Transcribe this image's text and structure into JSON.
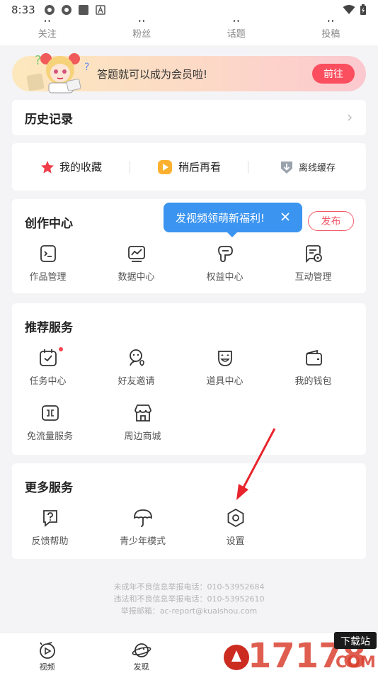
{
  "status_bar": {
    "time": "8:33"
  },
  "stats": [
    {
      "label": "关注"
    },
    {
      "label": "粉丝"
    },
    {
      "label": "话题"
    },
    {
      "label": "投稿"
    }
  ],
  "banner": {
    "text": "答题就可以成为会员啦!",
    "button": "前往"
  },
  "history": {
    "title": "历史记录"
  },
  "quick_links": [
    {
      "label": "我的收藏",
      "icon": "star-icon"
    },
    {
      "label": "稍后再看",
      "icon": "play-later-icon"
    },
    {
      "label": "离线缓存",
      "icon": "download-icon"
    }
  ],
  "create_center": {
    "title": "创作中心",
    "publish": "发布",
    "tooltip": "发视频领萌新福利!",
    "items": [
      {
        "label": "作品管理",
        "icon": "works-icon"
      },
      {
        "label": "数据中心",
        "icon": "data-icon"
      },
      {
        "label": "权益中心",
        "icon": "rights-icon"
      },
      {
        "label": "互动管理",
        "icon": "interaction-icon"
      }
    ]
  },
  "recommend": {
    "title": "推荐服务",
    "items": [
      {
        "label": "任务中心",
        "icon": "task-icon"
      },
      {
        "label": "好友邀请",
        "icon": "invite-friend-icon"
      },
      {
        "label": "道具中心",
        "icon": "props-icon"
      },
      {
        "label": "我的钱包",
        "icon": "wallet-icon"
      },
      {
        "label": "免流量服务",
        "icon": "free-data-icon"
      },
      {
        "label": "周边商城",
        "icon": "shop-icon"
      }
    ]
  },
  "more": {
    "title": "更多服务",
    "items": [
      {
        "label": "反馈帮助",
        "icon": "help-icon"
      },
      {
        "label": "青少年模式",
        "icon": "umbrella-icon"
      },
      {
        "label": "设置",
        "icon": "settings-icon"
      }
    ]
  },
  "footer": {
    "line1": "未成年不良信息举报电话：010-53952684",
    "line2": "违法和不良信息举报电话：010-53952610",
    "line3": "举报邮箱：ac-report@kuaishou.com"
  },
  "tabbar": [
    {
      "label": "视频",
      "icon": "video-tab-icon"
    },
    {
      "label": "发现",
      "icon": "planet-tab-icon"
    }
  ],
  "watermark": {
    "text": "17178",
    "badge": "下载站",
    "suffix": "COM"
  },
  "colors": {
    "accent": "#fb4e5e",
    "tooltip": "#3b94f0",
    "annotation_arrow": "#e8242c"
  }
}
